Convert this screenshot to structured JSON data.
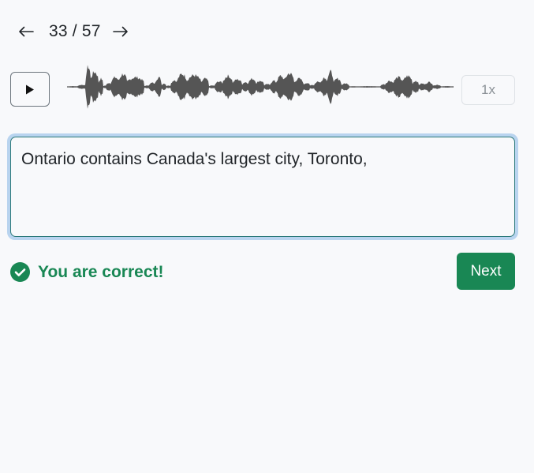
{
  "pager": {
    "counter": "33 / 57",
    "prev_icon": "arrow-left-icon",
    "next_icon": "arrow-right-icon"
  },
  "player": {
    "play_icon": "play-icon",
    "speed_label": "1x"
  },
  "answer": {
    "value": "Ontario contains Canada's largest city, Toronto,"
  },
  "feedback": {
    "icon": "check-circle-icon",
    "message": "You are correct!"
  },
  "actions": {
    "next_label": "Next"
  },
  "colors": {
    "success": "#198754",
    "focus_ring": "#b9d4ef",
    "waveform": "#555555"
  }
}
